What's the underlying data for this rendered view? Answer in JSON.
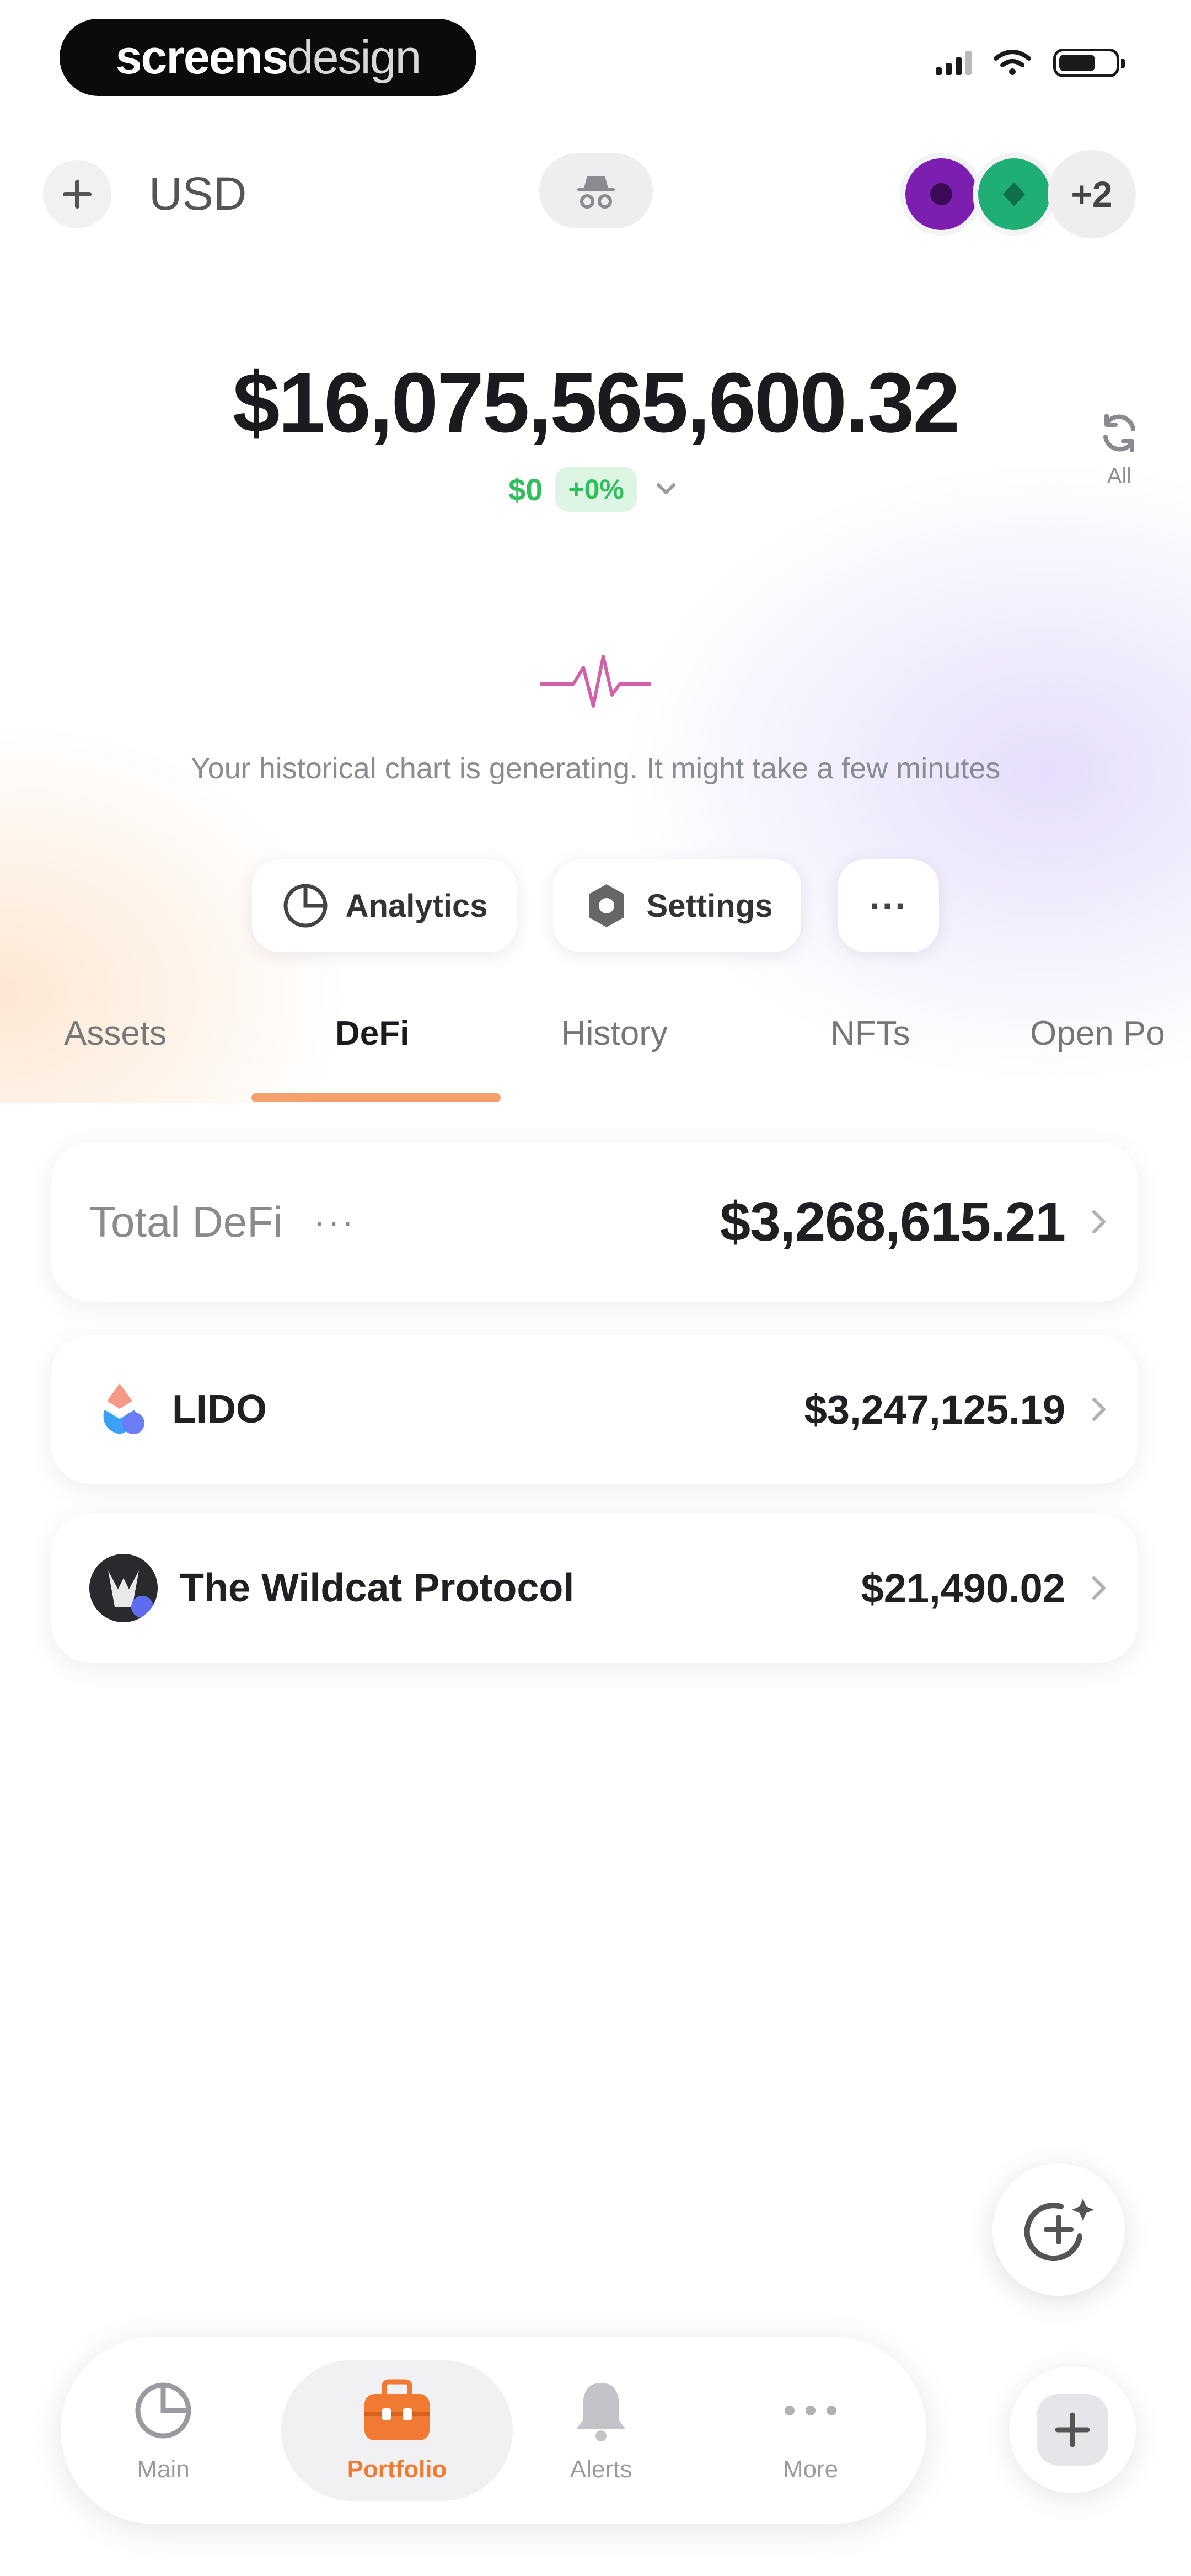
{
  "status_bar": {
    "brand_bold": "screens",
    "brand_light": "design",
    "icons": [
      "signal-icon",
      "wifi-icon",
      "battery-icon"
    ]
  },
  "header": {
    "add_icon": "plus-icon",
    "currency": "USD",
    "incognito_icon": "incognito-icon",
    "more_wallets": "+2"
  },
  "balance": {
    "total": "$16,075,565,600.32",
    "change_abs": "$0",
    "change_pct": "+0%",
    "refresh_label": "All"
  },
  "chart": {
    "message": "Your historical chart is generating. It might take a few minutes"
  },
  "actions": [
    {
      "label": "Analytics",
      "icon": "analytics-icon"
    },
    {
      "label": "Settings",
      "icon": "gear-icon"
    },
    {
      "label": "···",
      "icon": "more-icon"
    }
  ],
  "tabs": [
    {
      "label": "Assets",
      "active": false
    },
    {
      "label": "DeFi",
      "active": true
    },
    {
      "label": "History",
      "active": false
    },
    {
      "label": "NFTs",
      "active": false
    },
    {
      "label": "Open Po",
      "active": false
    }
  ],
  "defi": {
    "total_label": "Total DeFi",
    "total_menu": "···",
    "total_value": "$3,268,615.21",
    "protocols": [
      {
        "name": "LIDO",
        "value": "$3,247,125.19"
      },
      {
        "name": "The Wildcat Protocol",
        "value": "$21,490.02"
      }
    ]
  },
  "bottom_nav": [
    {
      "label": "Main",
      "icon": "pie-chart-icon",
      "active": false
    },
    {
      "label": "Portfolio",
      "icon": "briefcase-icon",
      "active": true
    },
    {
      "label": "Alerts",
      "icon": "bell-icon",
      "active": false
    },
    {
      "label": "More",
      "icon": "more-icon",
      "active": false
    }
  ],
  "colors": {
    "accent_orange": "#f07a32",
    "positive_green": "#2fbf5c",
    "tab_underline": "#f3a06c"
  }
}
